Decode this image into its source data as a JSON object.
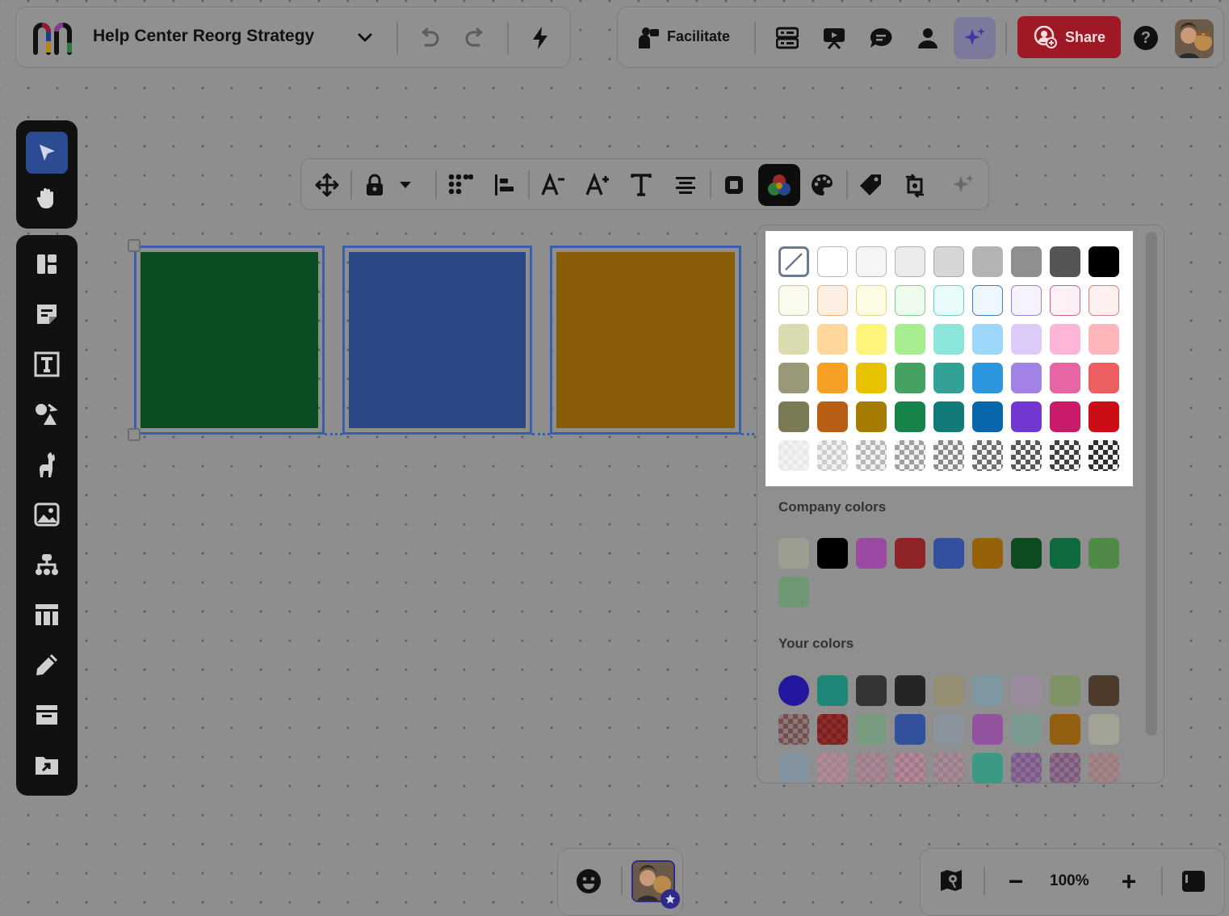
{
  "board": {
    "title": "Help Center Reorg Strategy",
    "logo": "miro-like-logo",
    "dropdown_icon": "chevron-down-icon",
    "undo_icon": "undo-icon",
    "redo_icon": "redo-icon",
    "lightning_icon": "lightning-icon"
  },
  "top_right": {
    "facilitate_label": "Facilitate",
    "share_label": "Share",
    "help_glyph": "?",
    "icons": [
      "list-icon",
      "presentation-icon",
      "comment-icon",
      "user-icon",
      "ai-sparkle-icon"
    ]
  },
  "left_toolbar": {
    "top_tools": [
      "select-cursor-icon",
      "hand-icon"
    ],
    "tools": [
      "templates-icon",
      "sticky-note-icon",
      "text-icon",
      "shapes-icon",
      "llama-icon",
      "image-icon",
      "mindmap-icon",
      "table-icon",
      "pen-icon",
      "frame-icon",
      "upload-icon"
    ]
  },
  "context_toolbar": {
    "tools": [
      "move-icon",
      "lock-icon",
      "caret-down-icon",
      "grid-layout-icon",
      "align-left-icon",
      "font-decrease-icon",
      "font-increase-icon",
      "text-style-icon",
      "align-center-icon",
      "border-icon",
      "color-fill-icon",
      "palette-icon",
      "tag-icon",
      "transform-icon",
      "ai-sparkle-icon"
    ],
    "active_tool": "color-fill-icon"
  },
  "canvas": {
    "shapes": [
      {
        "name": "green-square",
        "color": "#0b4d23"
      },
      {
        "name": "blue-square",
        "color": "#2c4786"
      },
      {
        "name": "mustard-square",
        "color": "#8a5d0b"
      }
    ]
  },
  "color_picker": {
    "selected": "no-fill",
    "rows": [
      [
        {
          "type": "none"
        },
        {
          "color": "#ffffff",
          "border": "#b8b8b8"
        },
        {
          "color": "#f5f5f5",
          "border": "#b8b8b8"
        },
        {
          "color": "#ebebeb",
          "border": "#b0b0b0"
        },
        {
          "color": "#d6d6d6",
          "border": "#a8a8a8"
        },
        {
          "color": "#b3b3b3"
        },
        {
          "color": "#8f8f8f"
        },
        {
          "color": "#555555"
        },
        {
          "color": "#000000"
        }
      ],
      [
        {
          "color": "#fafaee",
          "border": "#c8c39a"
        },
        {
          "color": "#fdf0e2",
          "border": "#f0b272"
        },
        {
          "color": "#fefbe5",
          "border": "#e8d47a"
        },
        {
          "color": "#eefaee",
          "border": "#7fcd8a"
        },
        {
          "color": "#e9fafa",
          "border": "#6fcfc6"
        },
        {
          "color": "#eef6ff",
          "border": "#3c7fc8"
        },
        {
          "color": "#f6f2ff",
          "border": "#9b7fe8"
        },
        {
          "color": "#fff0f5",
          "border": "#d65c95"
        },
        {
          "color": "#fff0f0",
          "border": "#e27a7a"
        }
      ],
      [
        {
          "color": "#dbdbb0"
        },
        {
          "color": "#ffd79a"
        },
        {
          "color": "#fef37c"
        },
        {
          "color": "#a8ec90"
        },
        {
          "color": "#8de6da"
        },
        {
          "color": "#9dd8fa"
        },
        {
          "color": "#dccaf9"
        },
        {
          "color": "#fdb6d5"
        },
        {
          "color": "#ffb6ba"
        }
      ],
      [
        {
          "color": "#999977"
        },
        {
          "color": "#f6a025"
        },
        {
          "color": "#e6c200"
        },
        {
          "color": "#45a160"
        },
        {
          "color": "#34a197"
        },
        {
          "color": "#2c96de"
        },
        {
          "color": "#a283e5"
        },
        {
          "color": "#e566a3"
        },
        {
          "color": "#ec5e60"
        }
      ],
      [
        {
          "color": "#7a7a54"
        },
        {
          "color": "#b85e15"
        },
        {
          "color": "#a67c00"
        },
        {
          "color": "#17834a"
        },
        {
          "color": "#127a78"
        },
        {
          "color": "#0866aa"
        },
        {
          "color": "#7237d0"
        },
        {
          "color": "#c81b6a"
        },
        {
          "color": "#cb0e15"
        }
      ],
      [
        {
          "checker": "#e8e8e8"
        },
        {
          "checker": "#cdcdcd"
        },
        {
          "checker": "#b8b8b8"
        },
        {
          "checker": "#a0a0a0"
        },
        {
          "checker": "#8a8a8a"
        },
        {
          "checker": "#6f6f6f"
        },
        {
          "checker": "#575757"
        },
        {
          "checker": "#404040"
        },
        {
          "checker": "#2e2e2e"
        }
      ]
    ],
    "company_colors_label": "Company colors",
    "company_colors": [
      "#9d9d92",
      "#000000",
      "#9a4aa2",
      "#8e2428",
      "#33509e",
      "#95620a",
      "#0e4b21",
      "#0f6a3d",
      "#4f8a47",
      "#6e9874"
    ],
    "your_colors_label": "Your colors",
    "your_colors": [
      {
        "color": "#22179d",
        "shape": "circle"
      },
      {
        "color": "#1f8777"
      },
      {
        "color": "#343434"
      },
      {
        "color": "#252525"
      },
      {
        "color": "#958f74"
      },
      {
        "color": "#7f97a0"
      },
      {
        "color": "#9a8b9f"
      },
      {
        "color": "#7f9266"
      },
      {
        "color": "#4d3b2b"
      },
      {
        "color": "#8d7777",
        "checker": "#6f4f4f"
      },
      {
        "color": "#8d2c2a",
        "checker": "#7a2222"
      },
      {
        "color": "#789a7e"
      },
      {
        "color": "#32519b"
      },
      {
        "color": "#8b949d"
      },
      {
        "color": "#92529e"
      },
      {
        "color": "#7c9a91"
      },
      {
        "color": "#935f10"
      },
      {
        "color": "#a3a395"
      },
      {
        "color": "#8393a0"
      },
      {
        "color": "#a08590",
        "checker": "#b28998"
      },
      {
        "color": "#9a7e8c",
        "checker": "#a88694"
      },
      {
        "color": "#a0798b",
        "checker": "#b4879b"
      },
      {
        "color": "#987f8b",
        "checker": "#a68a97"
      },
      {
        "color": "#3c9a84"
      },
      {
        "color": "#8b6d95",
        "checker": "#7a5a88"
      },
      {
        "color": "#8d6f8d",
        "checker": "#795a79"
      },
      {
        "color": "#987d80",
        "checker": "#a38586"
      }
    ]
  },
  "bottom_bar": {
    "zoom_level": "100%",
    "zoom_out_glyph": "−",
    "zoom_in_glyph": "+",
    "icons": [
      "emoji-icon",
      "map-icon",
      "panel-toggle-icon"
    ]
  },
  "colors": {
    "accent": "#3a5fa8",
    "share_button": "#9e1826",
    "toolbar_dark": "#111111"
  }
}
